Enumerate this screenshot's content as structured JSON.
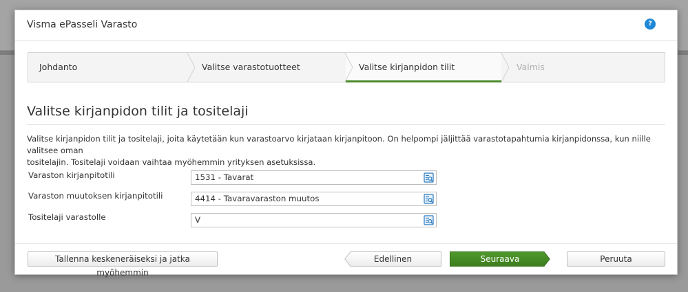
{
  "dialog": {
    "title": "Visma ePasseli Varasto",
    "help_icon": "question-icon",
    "help_glyph": "?"
  },
  "wizard": {
    "steps": [
      {
        "label": "Johdanto",
        "state": "done"
      },
      {
        "label": "Valitse varastotuotteet",
        "state": "done"
      },
      {
        "label": "Valitse kirjanpidon tilit",
        "state": "active"
      },
      {
        "label": "Valmis",
        "state": "disabled"
      }
    ]
  },
  "section": {
    "title": "Valitse kirjanpidon tilit ja tositelaji",
    "description_line1": "Valitse kirjanpidon tilit ja tositelaji, joita käytetään kun varastoarvo kirjataan kirjanpitoon. On helpompi jäljittää varastotapahtumia kirjanpidonssa, kun niille valitsee oman",
    "description_line2": "tositelajin. Tositelaji voidaan vaihtaa myöhemmin yrityksen asetuksissa."
  },
  "fields": [
    {
      "label": "Varaston kirjanpitotili",
      "value": "1531 - Tavarat",
      "icon": "lookup-icon"
    },
    {
      "label": "Varaston muutoksen kirjanpitotili",
      "value": "4414 - Tavaravaraston muutos",
      "icon": "lookup-icon"
    },
    {
      "label": "Tositelaji varastolle",
      "value": "V",
      "icon": "lookup-icon"
    }
  ],
  "footer": {
    "save_label": "Tallenna keskeneräiseksi ja jatka myöhemmin",
    "prev_label": "Edellinen",
    "next_label": "Seuraava",
    "cancel_label": "Peruuta"
  },
  "colors": {
    "accent_green": "#4a8a2a",
    "help_blue": "#1e87d6"
  }
}
